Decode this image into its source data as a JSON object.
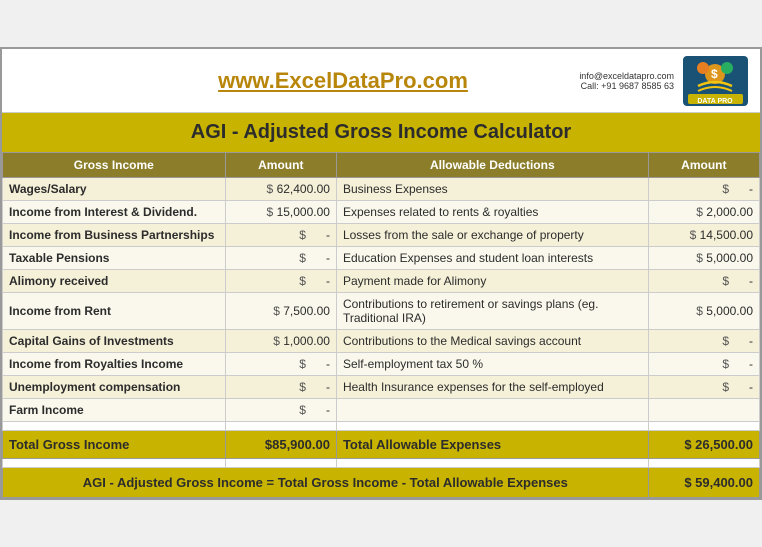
{
  "header": {
    "website": "www.ExcelDataPro.com",
    "info_line1": "info@exceldatapro.com",
    "info_line2": "Call: +91 9687 8585 63",
    "main_title": "AGI - Adjusted Gross Income Calculator"
  },
  "table": {
    "col_headers": {
      "gross_income": "Gross Income",
      "amount1": "Amount",
      "allowable_deductions": "Allowable Deductions",
      "amount2": "Amount"
    },
    "rows": [
      {
        "gross_label": "Wages/Salary",
        "gross_amount": "62,400.00",
        "deduction_label": "Business Expenses",
        "deduction_amount": "-"
      },
      {
        "gross_label": "Income from Interest & Dividend.",
        "gross_amount": "15,000.00",
        "deduction_label": "Expenses related to rents & royalties",
        "deduction_amount": "2,000.00"
      },
      {
        "gross_label": "Income from Business Partnerships",
        "gross_amount": "-",
        "deduction_label": "Losses from the sale or exchange of property",
        "deduction_amount": "14,500.00"
      },
      {
        "gross_label": "Taxable Pensions",
        "gross_amount": "-",
        "deduction_label": "Education Expenses and student loan interests",
        "deduction_amount": "5,000.00"
      },
      {
        "gross_label": "Alimony received",
        "gross_amount": "-",
        "deduction_label": "Payment made for Alimony",
        "deduction_amount": "-"
      },
      {
        "gross_label": "Income from Rent",
        "gross_amount": "7,500.00",
        "deduction_label": "Contributions to retirement or savings plans (eg. Traditional IRA)",
        "deduction_amount": "5,000.00"
      },
      {
        "gross_label": "Capital Gains of Investments",
        "gross_amount": "1,000.00",
        "deduction_label": "Contributions to the Medical savings account",
        "deduction_amount": "-"
      },
      {
        "gross_label": "Income from Royalties Income",
        "gross_amount": "-",
        "deduction_label": "Self-employment tax 50 %",
        "deduction_amount": "-"
      },
      {
        "gross_label": "Unemployment compensation",
        "gross_amount": "-",
        "deduction_label": "Health Insurance expenses for the self-employed",
        "deduction_amount": "-"
      },
      {
        "gross_label": "Farm Income",
        "gross_amount": "-",
        "deduction_label": "",
        "deduction_amount": ""
      }
    ],
    "total": {
      "gross_label": "Total Gross Income",
      "gross_amount": "$85,900.00",
      "deduction_label": "Total Allowable Expenses",
      "deduction_amount": "$ 26,500.00"
    },
    "agi": {
      "label": "AGI - Adjusted Gross Income = Total Gross Income - Total Allowable Expenses",
      "amount": "$ 59,400.00"
    }
  }
}
